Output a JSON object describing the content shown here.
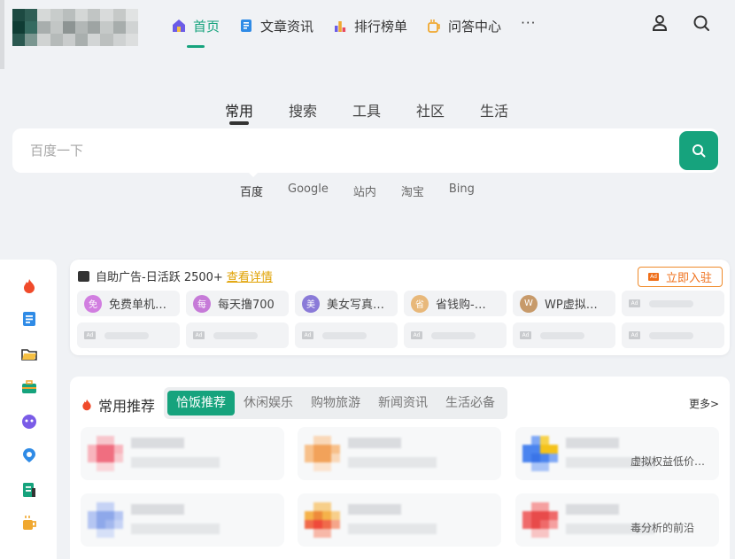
{
  "nav": {
    "items": [
      {
        "label": "首页",
        "icon": "home-icon",
        "active": true
      },
      {
        "label": "文章资讯",
        "icon": "article-icon"
      },
      {
        "label": "排行榜单",
        "icon": "ranking-icon"
      },
      {
        "label": "问答中心",
        "icon": "qa-cup-icon"
      }
    ],
    "more": "···"
  },
  "search": {
    "tabs": [
      "常用",
      "搜索",
      "工具",
      "社区",
      "生活"
    ],
    "placeholder": "百度一下",
    "engines": [
      "百度",
      "Google",
      "站内",
      "淘宝",
      "Bing"
    ]
  },
  "ad": {
    "head_text": "自助广告-日活跃 2500+",
    "head_link": "查看详情",
    "enter_label": "立即入驻",
    "tag": "Ad",
    "items": [
      {
        "avatar": "免",
        "label": "免费单机…",
        "color": "#d17ee0"
      },
      {
        "avatar": "每",
        "label": "每天撸700",
        "color": "#c67ad8"
      },
      {
        "avatar": "美",
        "label": "美女写真…",
        "color": "#8a7ad8"
      },
      {
        "avatar": "省",
        "label": "省钱购-…",
        "color": "#e8b87a"
      },
      {
        "avatar": "W",
        "label": "WP虚拟…",
        "color": "#c79a6a"
      }
    ]
  },
  "recommend": {
    "title": "常用推荐",
    "tabs": [
      "恰饭推荐",
      "休闲娱乐",
      "购物旅游",
      "新闻资讯",
      "生活必备"
    ],
    "more": "更多>",
    "tile_desc_1": "虚拟权益低价…",
    "tile_desc_2": "毒分析的前沿"
  },
  "colors": {
    "accent": "#16a37d",
    "ad_orange": "#ef6f1a"
  }
}
